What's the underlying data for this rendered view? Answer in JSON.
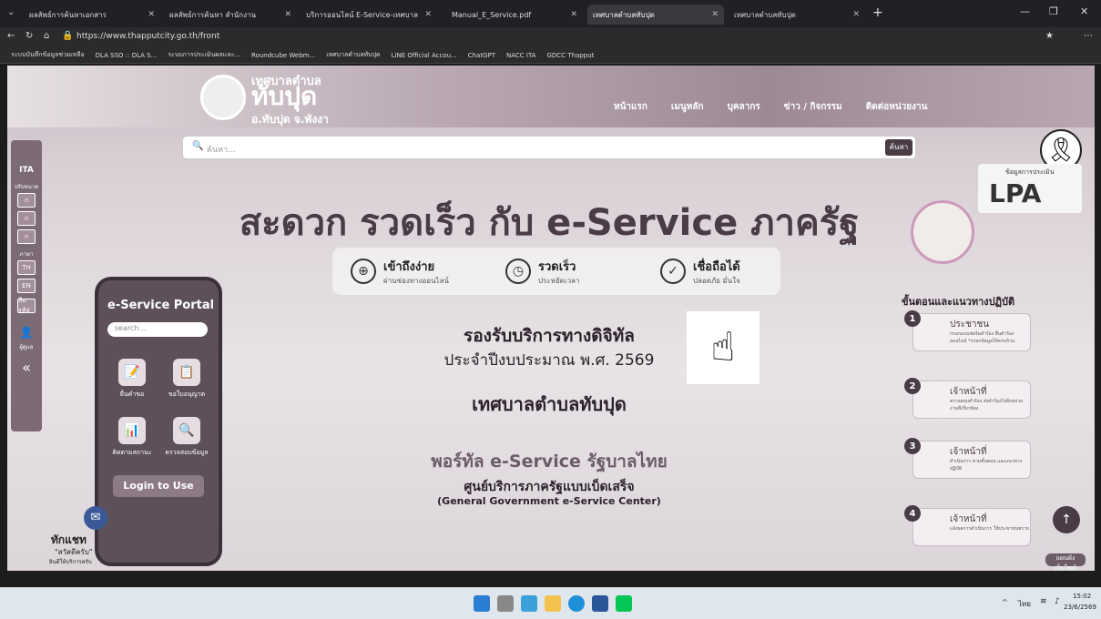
{
  "browser": {
    "tabs": [
      {
        "label": "ผลลัพธ์การค้นหาเอกสาร",
        "active": false
      },
      {
        "label": "ผลลัพธ์การค้นหา สำนักงาน",
        "active": false
      },
      {
        "label": "บริการออนไลน์ E-Service-เทศบาล",
        "active": false
      },
      {
        "label": "Manual_E_Service.pdf",
        "active": false
      },
      {
        "label": "เทศบาลตำบลทับปุด",
        "active": true
      },
      {
        "label": "เทศบาลตำบลทับปุด",
        "active": false
      }
    ],
    "url": "https://www.thapputcity.go.th/front",
    "favorites": [
      "ระบบบันทึกข้อมูลช่วยเหลือ",
      "DLA SSO :: DLA S...",
      "ระบบการประเมินผลและ...",
      "Roundcube Webm...",
      "เทศบาลตำบลทับปุด",
      "LINE Official Accou...",
      "ChatGPT",
      "NACC ITA",
      "GDCC Thapput"
    ]
  },
  "site": {
    "brand_top": "เทศบาลตำบล",
    "brand_name": "ทับปุด",
    "brand_sub": "อ.ทับปุด จ.พังงา",
    "nav": [
      "หน้าแรก",
      "เมนูหลัก",
      "บุคลากร",
      "ข่าว / กิจกรรม",
      "ติดต่อหน่วยงาน"
    ],
    "search_placeholder": "ค้นหา...",
    "search_button": "ค้นหา",
    "sidebar": {
      "adjust": "ปรับขนาด",
      "sizes": [
        "ก",
        "ก",
        "ก"
      ],
      "lang_label": "ภาษา",
      "langs": [
        "TH",
        "EN"
      ],
      "misc": "ลืมรหัส",
      "user": "ผู้ดูแล",
      "collapse": "«"
    },
    "badge_lpa_title": "ข้อมูลการประเมิน",
    "badge_lpa": "LPA",
    "hero": "สะดวก รวดเร็ว กับ e-Service ภาครัฐ",
    "features": [
      {
        "title": "เข้าถึงง่าย",
        "sub": "ผ่านช่องทางออนไลน์",
        "icon": "globe-icon"
      },
      {
        "title": "รวดเร็ว",
        "sub": "ประหยัดเวลา",
        "icon": "clock-icon"
      },
      {
        "title": "เชื่อถือได้",
        "sub": "ปลอดภัย มั่นใจ",
        "icon": "shield-check-icon"
      }
    ],
    "support_line1": "รองรับบริการทางดิจิทัล",
    "support_line2": "ประจำปีงบประมาณ พ.ศ. 2569",
    "municipality": "เทศบาลตำบลทับปุด",
    "portal_title": "พอร์ทัล e-Service รัฐบาลไทย",
    "center_th": "ศูนย์บริการภาครัฐแบบเบ็ดเสร็จ",
    "center_en": "(General Government e-Service Center)",
    "phone": {
      "title": "e-Service Portal",
      "search": "search...",
      "buttons": [
        "ยื่นคำขอ",
        "ขอใบอนุญาต",
        "ติดตามสถานะ",
        "ตรวจสอบข้อมูล"
      ],
      "login": "Login to Use"
    },
    "steps_title": "ขั้นตอนและแนวทางปฏิบัติ",
    "steps": [
      {
        "num": "1",
        "title": "ประชาชน",
        "desc": "กรอกแบบฟอร์มคำร้อง ยื่นคำร้องออนไลน์ *กรอกข้อมูลให้ครบถ้วน"
      },
      {
        "num": "2",
        "title": "เจ้าหน้าที่",
        "desc": "ตรวจสอบคำร้อง ส่งคำร้องไปยังหน่วยงานที่เกี่ยวข้อง"
      },
      {
        "num": "3",
        "title": "เจ้าหน้าที่",
        "desc": "ดำเนินการ ตามขั้นตอน และแนวทางปฏิบัติ"
      },
      {
        "num": "4",
        "title": "เจ้าหน้าที่",
        "desc": "แจ้งผลการดำเนินการ ให้ประชาชนทราบ"
      }
    ],
    "chat_title": "ทักแชท",
    "chat_sub": "\"สวัสดีครับ\"",
    "chat_sub2": "ยินดีให้บริการครับ",
    "map_label": "แผนผัง เว็บไซต์"
  },
  "taskbar": {
    "lang": "ไทย",
    "time": "15:02",
    "date": "23/6/2569"
  }
}
